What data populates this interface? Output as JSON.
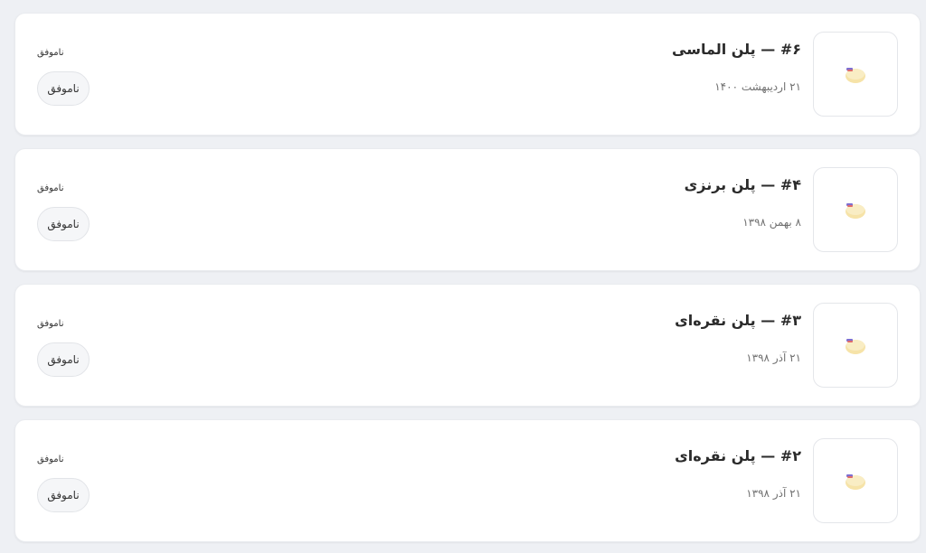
{
  "orders": [
    {
      "title": "#۶ — پلن الماسی",
      "date": "۲۱ اردیبهشت ۱۴۰۰",
      "status_label": "ناموفق",
      "status_button": "ناموفق"
    },
    {
      "title": "#۴ — پلن برنزی",
      "date": "۸ بهمن ۱۳۹۸",
      "status_label": "ناموفق",
      "status_button": "ناموفق"
    },
    {
      "title": "#۳ — پلن نقره‌ای",
      "date": "۲۱ آذر ۱۳۹۸",
      "status_label": "ناموفق",
      "status_button": "ناموفق"
    },
    {
      "title": "#۲ — پلن نقره‌ای",
      "date": "۲۱ آذر ۱۳۹۸",
      "status_label": "ناموفق",
      "status_button": "ناموفق"
    }
  ],
  "icon": "plan-package-icon",
  "colors": {
    "card_bg": "#ffffff",
    "page_bg": "#eef0f4",
    "pill_bg": "#f5f6f8"
  }
}
